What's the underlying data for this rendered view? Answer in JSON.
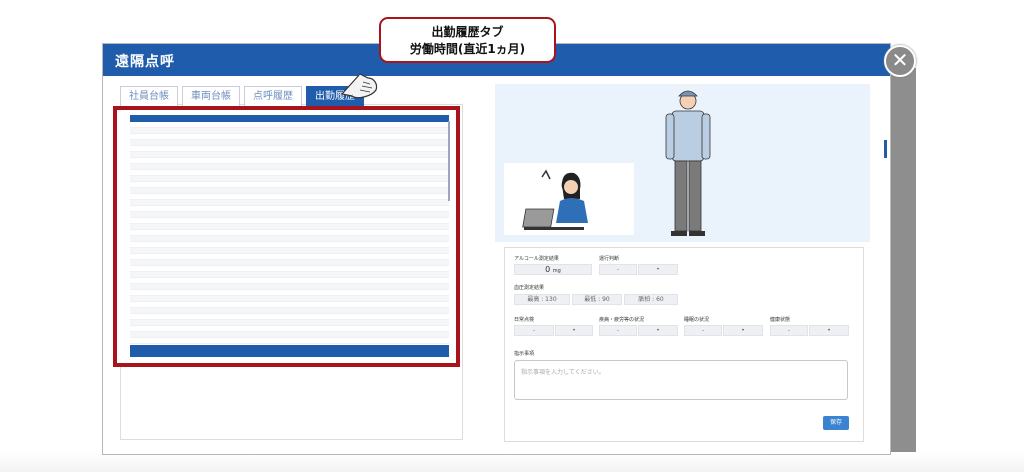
{
  "modal": {
    "title": "遠隔点呼",
    "close_glyph": "✕"
  },
  "tabs": [
    {
      "label": "社員台帳",
      "active": false
    },
    {
      "label": "車両台帳",
      "active": false
    },
    {
      "label": "点呼履歴",
      "active": false
    },
    {
      "label": "出勤履歴",
      "active": true
    }
  ],
  "callout": {
    "line1": "出勤履歴タブ",
    "line2": "労働時間(直近1ヵ月)"
  },
  "form": {
    "alcohol_label": "アルコール測定結果",
    "alcohol_value": "0",
    "alcohol_unit": "mg",
    "judgment_label": "運行判断",
    "bp_label": "血圧測定結果",
    "bp_high": "最高 : 130",
    "bp_low": "最低 : 90",
    "pulse": "脈拍 : 60",
    "daily_check_label": "日常点検",
    "illness_label": "疾病・疲労等の状況",
    "sleep_label": "睡眠の状況",
    "health_label": "健康状態",
    "instructions_label": "指示事項",
    "instructions_placeholder": "指示事項を入力してください。",
    "save_label": "保存"
  },
  "colors": {
    "header": "#1f5cac",
    "highlight": "#a9141c",
    "save": "#3a83d0"
  }
}
